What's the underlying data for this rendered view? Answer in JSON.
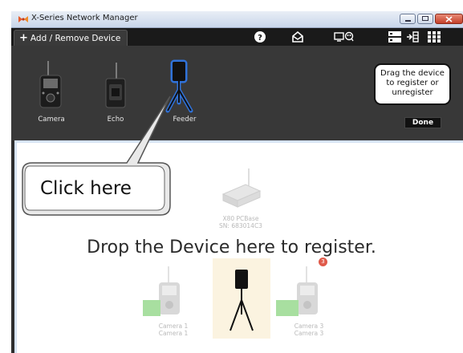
{
  "window": {
    "title": "X-Series Network Manager"
  },
  "toolbar": {
    "tab_label": "Add / Remove Device",
    "tab_plus": "+",
    "icons": [
      "help-icon",
      "message-icon",
      "display-icon",
      "network-icon",
      "grid-icon"
    ]
  },
  "tray": {
    "devices": [
      {
        "label": "Camera",
        "icon": "camera-device-icon"
      },
      {
        "label": "Echo",
        "icon": "echo-device-icon"
      },
      {
        "label": "Feeder",
        "icon": "feeder-device-icon",
        "selected": true
      }
    ],
    "hint": [
      "Drag the device",
      "to register or",
      "unregister"
    ],
    "done_label": "Done"
  },
  "drop_area": {
    "instruction": "Drop the Device here to register.",
    "base": {
      "name": "X80 PCBase",
      "serial": "SN: 683014C3"
    },
    "cameras": [
      {
        "line1": "Camera 1",
        "line2": "Camera 1"
      },
      {
        "line1": "Camera 3",
        "line2": "Camera 3",
        "badge": "3"
      }
    ]
  },
  "callout": {
    "text": "Click here"
  },
  "colors": {
    "accent_glow": "#2f7df6",
    "toolbar_bg": "#1a1a1a",
    "tray_bg": "#383838",
    "badge": "#e05a4a"
  }
}
